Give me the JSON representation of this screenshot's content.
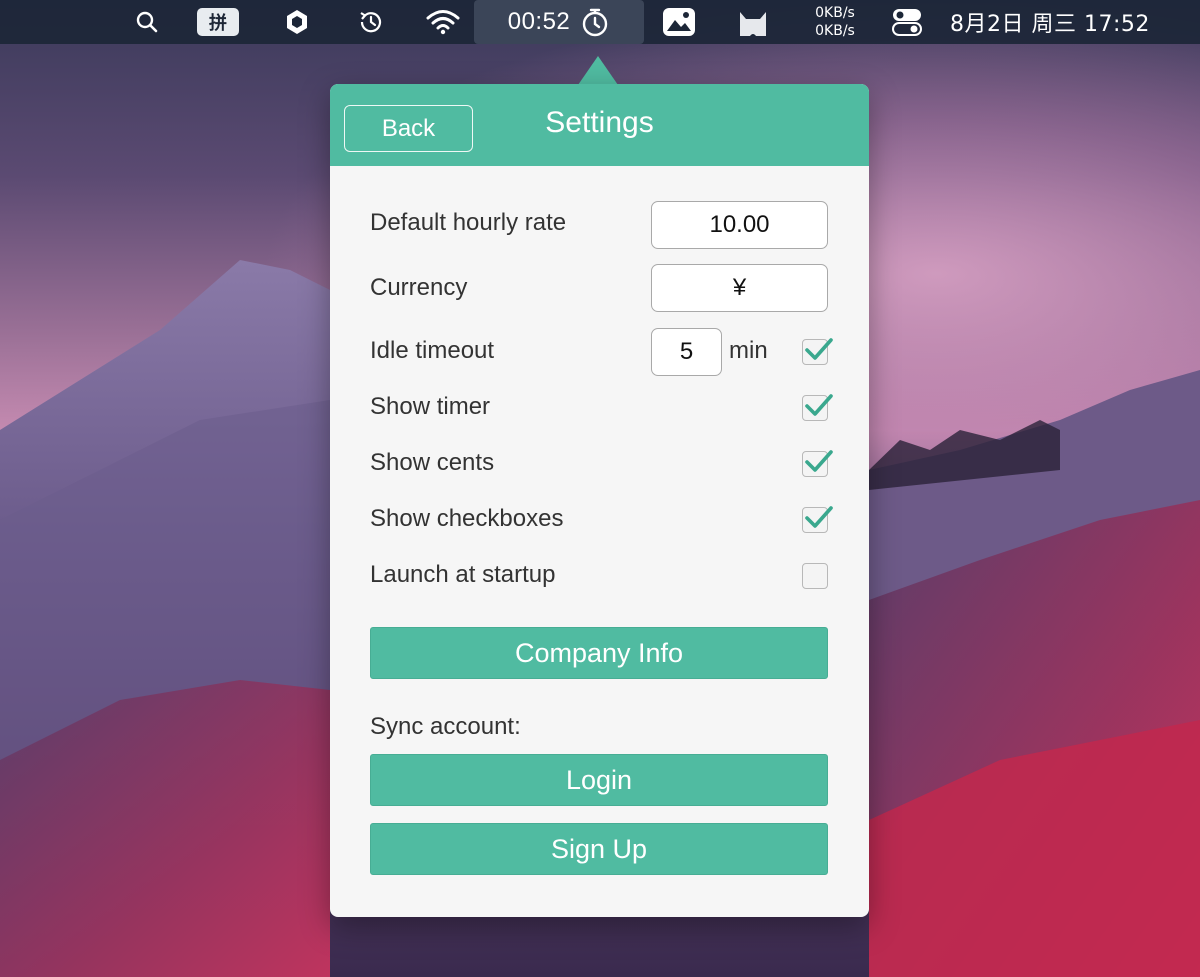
{
  "menubar": {
    "ime_label": "拼",
    "timer_text": "00:52",
    "net_up": "0KB/s",
    "net_down": "0KB/s",
    "datetime": "8月2日 周三  17:52",
    "icons": [
      "search-icon",
      "input-method-icon",
      "hexagon-icon",
      "history-icon",
      "wifi-icon",
      "stopwatch-icon",
      "photo-icon",
      "cat-icon",
      "control-center-icon"
    ]
  },
  "settings": {
    "back_label": "Back",
    "title": "Settings",
    "hourly_rate_label": "Default hourly rate",
    "hourly_rate_value": "10.00",
    "currency_label": "Currency",
    "currency_value": "¥",
    "idle_label": "Idle timeout",
    "idle_value": "5",
    "idle_unit": "min",
    "idle_checked": true,
    "show_timer_label": "Show timer",
    "show_timer_checked": true,
    "show_cents_label": "Show cents",
    "show_cents_checked": true,
    "show_checkboxes_label": "Show checkboxes",
    "show_checkboxes_checked": true,
    "launch_label": "Launch at startup",
    "launch_checked": false,
    "company_info_label": "Company Info",
    "sync_label": "Sync account:",
    "login_label": "Login",
    "signup_label": "Sign Up"
  },
  "colors": {
    "accent": "#50bba1",
    "checkmark": "#3aa88e",
    "menubar": "#1c2637"
  }
}
